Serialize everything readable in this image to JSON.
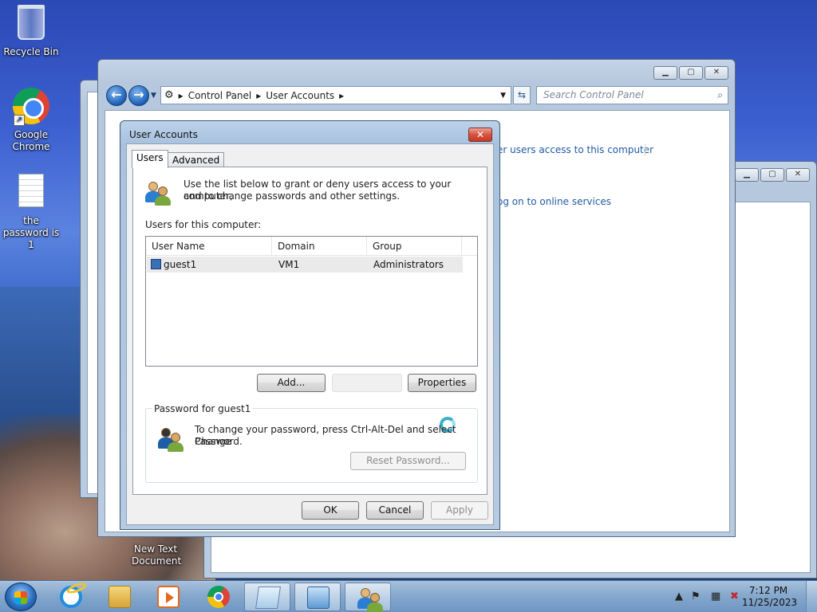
{
  "desktop": {
    "icons": [
      {
        "label": "Recycle Bin"
      },
      {
        "label": "Google Chrome"
      },
      {
        "label": "the password is 1"
      },
      {
        "label": "New Text Document"
      }
    ]
  },
  "control_panel": {
    "breadcrumb": [
      "Control Panel",
      "User Accounts"
    ],
    "search_placeholder": "Search Control Panel",
    "links": [
      "er users access to this computer",
      "og on to online services"
    ]
  },
  "dialog": {
    "title": "User Accounts",
    "tabs": [
      "Users",
      "Advanced"
    ],
    "active_tab": "Users",
    "intro_text_1": "Use the list below to grant or deny users access to your computer,",
    "intro_text_2": "and to change passwords and other settings.",
    "users_label": "Users for this computer:",
    "columns": [
      "User Name",
      "Domain",
      "Group"
    ],
    "users": [
      {
        "name": "guest1",
        "domain": "VM1",
        "group": "Administrators"
      }
    ],
    "add_button": "Add...",
    "properties_button": "Properties",
    "password_group_label": "Password for guest1",
    "password_text_1": "To change your password, press Ctrl-Alt-Del and select Change",
    "password_text_2": "Password.",
    "reset_password_button": "Reset Password...",
    "ok_button": "OK",
    "cancel_button": "Cancel",
    "apply_button": "Apply"
  },
  "taskbar": {
    "time": "7:12 PM",
    "date": "11/25/2023"
  }
}
